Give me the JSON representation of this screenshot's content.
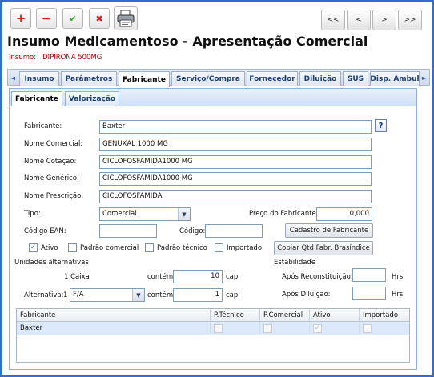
{
  "toolbar": {
    "add_icon": "+",
    "remove_icon": "−",
    "confirm_icon": "✔",
    "cancel_icon": "✖",
    "print_icon": "printer-icon",
    "nav_first": "<<",
    "nav_prev": "<",
    "nav_next": ">",
    "nav_last": ">>"
  },
  "header": {
    "title": "Insumo Medicamentoso - Apresentação Comercial",
    "insumo_label": "Insumo:",
    "insumo_value": "DIPIRONA 500MG"
  },
  "tabs": [
    "Insumo",
    "Parâmetros",
    "Fabricante",
    "Serviço/Compra",
    "Fornecedor",
    "Diluição",
    "SUS",
    "Disp. Ambul"
  ],
  "active_tab": "Fabricante",
  "subtabs": [
    "Fabricante",
    "Valorização"
  ],
  "form": {
    "fabricante_label": "Fabricante:",
    "fabricante_value": "Baxter",
    "help_icon": "?",
    "nome_comercial_label": "Nome Comercial:",
    "nome_comercial_value": "GENUXAL 1000 MG",
    "nome_cotacao_label": "Nome Cotação:",
    "nome_cotacao_value": "CICLOFOSFAMIDA1000 MG",
    "nome_generico_label": "Nome Genérico:",
    "nome_generico_value": "CICLOFOSFAMIDA1000 MG",
    "nome_prescricao_label": "Nome Prescrição:",
    "nome_prescricao_value": "CICLOFOSFAMIDA",
    "tipo_label": "Tipo:",
    "tipo_value": "Comercial",
    "preco_label": "Preço do Fabricante:",
    "preco_value": "0,000",
    "ean_label": "Código EAN:",
    "ean_value": "",
    "codigo_label": "Código:",
    "codigo_value": "",
    "cadastro_button": "Cadastro de Fabricante",
    "copiar_button": "Copiar Qtd Fabr. Brasíndice",
    "ativo_label": "Ativo",
    "padrao_comercial_label": "Padrão comercial",
    "padrao_tecnico_label": "Padrão técnico",
    "importado_label": "Importado",
    "check_mark": "✓"
  },
  "unidades": {
    "section_label": "Unidades alternativas",
    "row1_qty": "1 Caixa",
    "contem_label": "contém",
    "row1_value": "10",
    "unit_label": "cap",
    "alternativa_label": "Alternativa:",
    "alternativa_num": "1",
    "alternativa_select": "F/A",
    "row2_value": "1"
  },
  "estabilidade": {
    "section_label": "Estabilidade",
    "reconstituicao_label": "Após Reconstituição:",
    "reconstituicao_value": "",
    "diluicao_label": "Após Diluição:",
    "diluicao_value": "",
    "hrs_label": "Hrs"
  },
  "grid": {
    "columns": [
      "Fabricante",
      "P.Técnico",
      "P.Comercial",
      "Ativo",
      "Importado"
    ],
    "rows": [
      {
        "fabricante": "Baxter",
        "p_tecnico": false,
        "p_comercial": false,
        "ativo": true,
        "importado": false
      }
    ]
  }
}
